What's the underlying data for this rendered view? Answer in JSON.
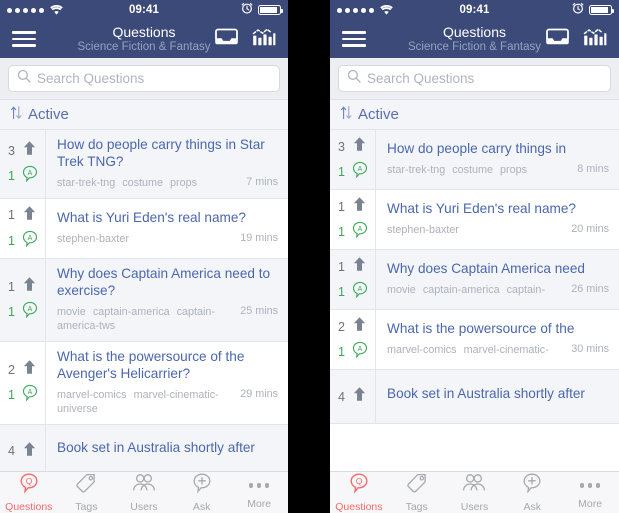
{
  "status_bar": {
    "time": "09:41",
    "signal_dots": 5,
    "wifi_icon": "wifi-icon",
    "alarm_icon": "alarm-clock-icon",
    "battery_icon": "battery-icon"
  },
  "nav": {
    "menu_icon": "hamburger-menu-icon",
    "title": "Questions",
    "subtitle": "Science Fiction & Fantasy",
    "inbox_icon": "inbox-tray-icon",
    "achievements_icon": "bar-chart-icon"
  },
  "search": {
    "placeholder": "Search Questions",
    "icon": "search-icon",
    "value": ""
  },
  "sort": {
    "label": "Active",
    "icon": "sort-arrows-icon"
  },
  "colors": {
    "nav_background": "#3b4a78",
    "title_link": "#4a67ad",
    "answer_green": "#3aa757",
    "active_tab_red": "#f56a6a",
    "muted_text": "#adb2bb",
    "row_alt_background": "#f3f5f9"
  },
  "left_panel": {
    "questions": [
      {
        "votes": "3",
        "answers": "1",
        "title": "How do people carry things in Star Trek TNG?",
        "tags": [
          "star-trek-tng",
          "costume",
          "props"
        ],
        "time": "7 mins"
      },
      {
        "votes": "1",
        "answers": "1",
        "title": "What is Yuri Eden's real name?",
        "tags": [
          "stephen-baxter"
        ],
        "time": "19 mins"
      },
      {
        "votes": "1",
        "answers": "1",
        "title": "Why does Captain America need to exercise?",
        "tags": [
          "movie",
          "captain-america",
          "captain-america-tws"
        ],
        "time": "25 mins"
      },
      {
        "votes": "2",
        "answers": "1",
        "title": "What is the powersource of the Avenger's Helicarrier?",
        "tags": [
          "marvel-comics",
          "marvel-cinematic-universe"
        ],
        "time": "29 mins"
      },
      {
        "votes": "4",
        "answers": "",
        "title": "Book set in Australia shortly after",
        "tags": [],
        "time": ""
      }
    ]
  },
  "right_panel": {
    "questions": [
      {
        "votes": "3",
        "answers": "1",
        "title": "How do people carry things in",
        "tags": [
          "star-trek-tng",
          "costume",
          "props"
        ],
        "time": "8 mins"
      },
      {
        "votes": "1",
        "answers": "1",
        "title": "What is Yuri Eden's real name?",
        "tags": [
          "stephen-baxter"
        ],
        "time": "20 mins"
      },
      {
        "votes": "1",
        "answers": "1",
        "title": "Why does Captain America need",
        "tags": [
          "movie",
          "captain-america",
          "captain-"
        ],
        "time": "26 mins"
      },
      {
        "votes": "2",
        "answers": "1",
        "title": "What is the powersource of the",
        "tags": [
          "marvel-comics",
          "marvel-cinematic-"
        ],
        "time": "30 mins"
      },
      {
        "votes": "4",
        "answers": "",
        "title": "Book set in Australia shortly after",
        "tags": [],
        "time": ""
      }
    ]
  },
  "tabbar": {
    "tabs": [
      {
        "label": "Questions",
        "icon": "question-bubble-icon",
        "active": true
      },
      {
        "label": "Tags",
        "icon": "tag-icon",
        "active": false
      },
      {
        "label": "Users",
        "icon": "users-icon",
        "active": false
      },
      {
        "label": "Ask",
        "icon": "plus-bubble-icon",
        "active": false
      },
      {
        "label": "More",
        "icon": "ellipsis-icon",
        "active": false
      }
    ]
  }
}
